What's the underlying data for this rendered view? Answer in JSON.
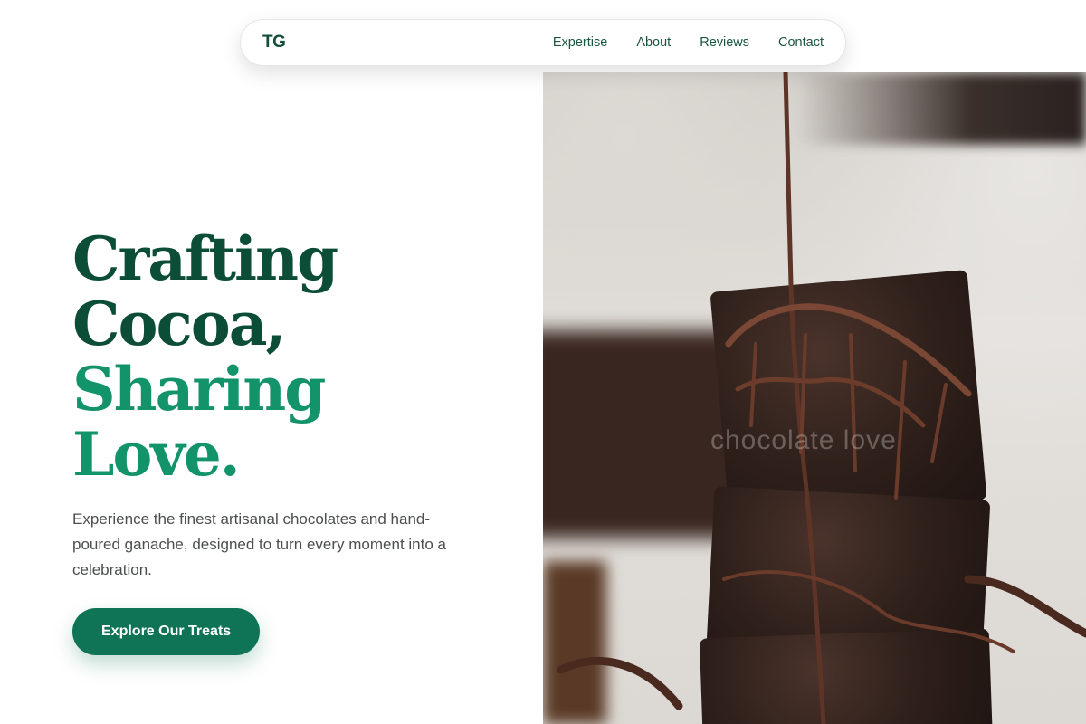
{
  "nav": {
    "logo": "TG",
    "links": [
      "Expertise",
      "About",
      "Reviews",
      "Contact"
    ]
  },
  "hero": {
    "headline": [
      "Crafting",
      "Cocoa,",
      "Sharing",
      "Love."
    ],
    "tagline": "Experience the finest artisanal chocolates and hand-poured ganache, designed to turn every moment into a celebration.",
    "cta_label": "Explore Our Treats",
    "image_watermark": "chocolate love"
  },
  "colors": {
    "brand_dark": "#0c4d37",
    "brand_green": "#12936a",
    "button": "#0f7355"
  }
}
